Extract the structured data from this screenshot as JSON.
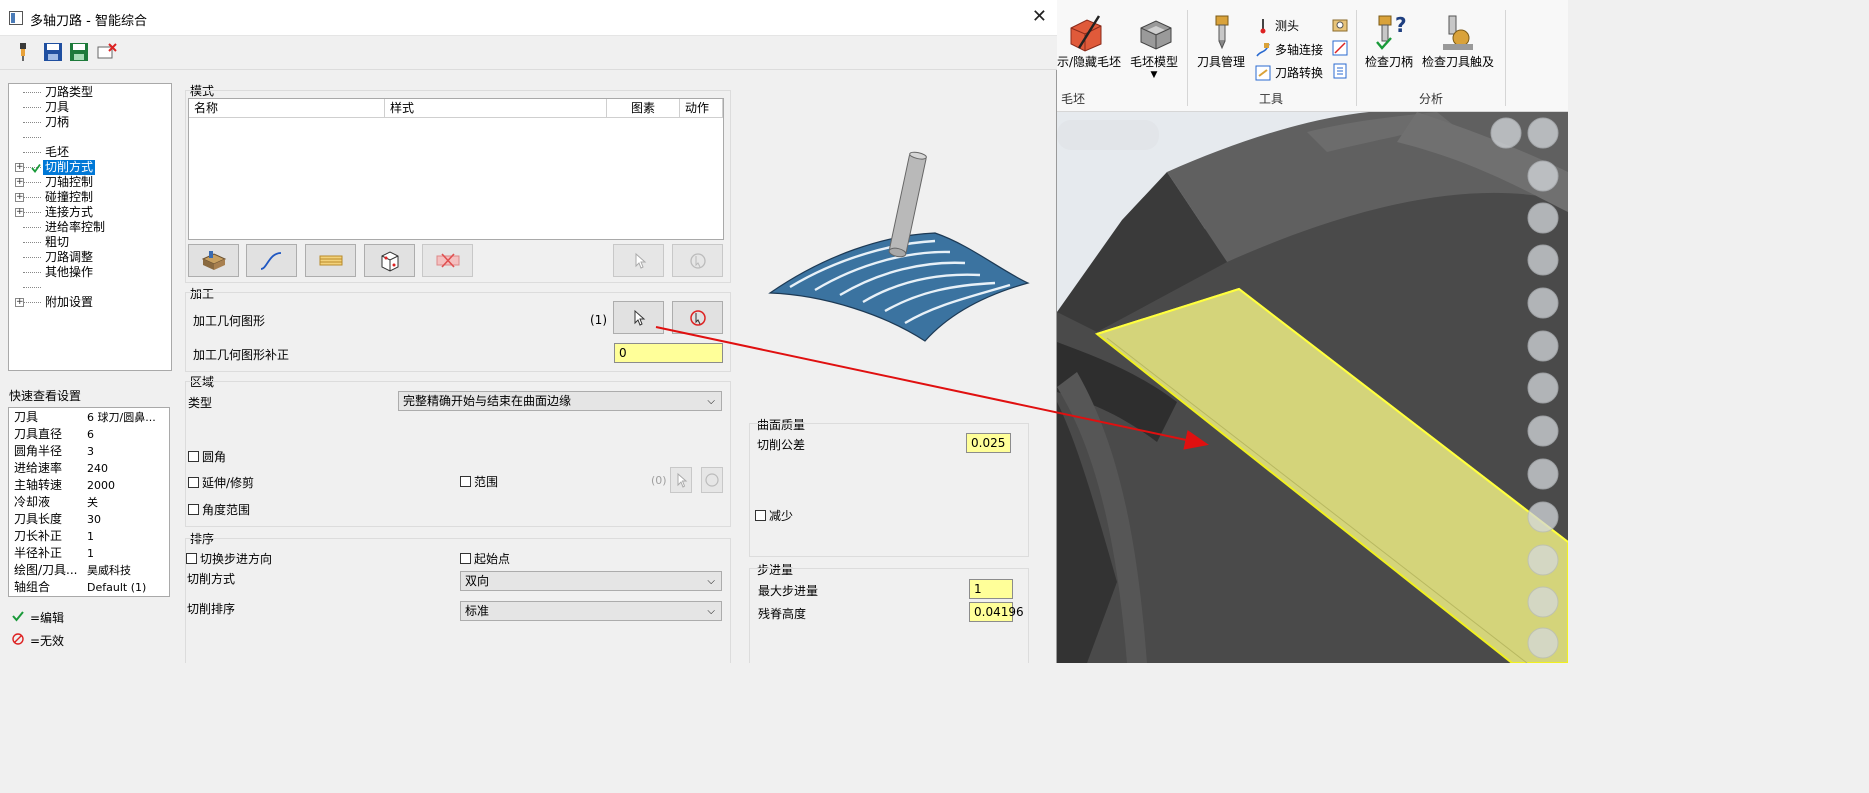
{
  "window": {
    "title": "多轴刀路 - 智能综合",
    "close_glyph": "✕"
  },
  "toolbar": {
    "icons": [
      "tool-icon",
      "save-icon",
      "save-as-icon",
      "delete-icon"
    ]
  },
  "tree": {
    "items": [
      {
        "label": "刀路类型",
        "expandable": false,
        "checked": false,
        "selected": false
      },
      {
        "label": "刀具",
        "expandable": false,
        "checked": false,
        "selected": false
      },
      {
        "label": "刀柄",
        "expandable": false,
        "checked": false,
        "selected": false
      },
      {
        "label": "",
        "expandable": false,
        "checked": false,
        "selected": false
      },
      {
        "label": "毛坯",
        "expandable": false,
        "checked": false,
        "selected": false
      },
      {
        "label": "切削方式",
        "expandable": true,
        "checked": true,
        "selected": true
      },
      {
        "label": "刀轴控制",
        "expandable": true,
        "checked": false,
        "selected": false
      },
      {
        "label": "碰撞控制",
        "expandable": true,
        "checked": false,
        "selected": false
      },
      {
        "label": "连接方式",
        "expandable": true,
        "checked": false,
        "selected": false
      },
      {
        "label": "进给率控制",
        "expandable": false,
        "checked": false,
        "selected": false
      },
      {
        "label": "粗切",
        "expandable": false,
        "checked": false,
        "selected": false
      },
      {
        "label": "刀路调整",
        "expandable": false,
        "checked": false,
        "selected": false
      },
      {
        "label": "其他操作",
        "expandable": false,
        "checked": false,
        "selected": false
      },
      {
        "label": "",
        "expandable": false,
        "checked": false,
        "selected": false
      },
      {
        "label": "附加设置",
        "expandable": true,
        "checked": false,
        "selected": false
      }
    ]
  },
  "quick_settings": {
    "title": "快速查看设置",
    "rows": [
      {
        "key": "刀具",
        "value": "6 球刀/圆鼻..."
      },
      {
        "key": "刀具直径",
        "value": "6"
      },
      {
        "key": "圆角半径",
        "value": "3"
      },
      {
        "key": "进给速率",
        "value": "240"
      },
      {
        "key": "主轴转速",
        "value": "2000"
      },
      {
        "key": "冷却液",
        "value": "关"
      },
      {
        "key": "刀具长度",
        "value": "30"
      },
      {
        "key": "刀长补正",
        "value": "1"
      },
      {
        "key": "半径补正",
        "value": "1"
      },
      {
        "key": "绘图/刀具...",
        "value": "昊威科技"
      },
      {
        "key": "轴组合",
        "value": "Default (1)"
      }
    ]
  },
  "legend": {
    "edit_label": "=编辑",
    "invalid_label": "=无效"
  },
  "pattern": {
    "title": "模式",
    "columns": [
      "名称",
      "样式",
      "图素",
      "动作"
    ]
  },
  "machining": {
    "title": "加工",
    "geometry_label": "加工几何图形",
    "geometry_count": "(1)",
    "offset_label": "加工几何图形补正",
    "offset_value": "0"
  },
  "region": {
    "title": "区域",
    "type_label": "类型",
    "type_value": "完整精确开始与结束在曲面边缘",
    "fillet_label": "圆角",
    "extend_label": "延伸/修剪",
    "range_label": "范围",
    "range_count": "(0)",
    "angle_range_label": "角度范围"
  },
  "surface_quality": {
    "title": "曲面质量",
    "tolerance_label": "切削公差",
    "tolerance_value": "0.025",
    "reduce_label": "减少"
  },
  "sorting": {
    "title": "排序",
    "switch_label": "切换步进方向",
    "start_label": "起始点",
    "cut_method_label": "切削方式",
    "cut_method_value": "双向",
    "cut_order_label": "切削排序",
    "cut_order_value": "标准"
  },
  "stepover": {
    "title": "步进量",
    "max_label": "最大步进量",
    "max_value": "1",
    "scallop_label": "残脊高度",
    "scallop_value": "0.04196"
  },
  "ribbon": {
    "show_hide_stock": "示/隐藏毛坯",
    "stock_model": "毛坯模型",
    "tool_manager": "刀具管理",
    "probe": "测头",
    "multiaxis_link": "多轴连接",
    "toolpath_transform": "刀路转换",
    "check_holder": "检查刀柄",
    "check_tool_reach": "检查刀具触及",
    "group_stock": "毛坯",
    "group_tools": "工具",
    "group_analysis": "分析"
  },
  "colors": {
    "accent_blue": "#0078d7",
    "input_yellow": "#ffff99",
    "arrow_red": "#e01010",
    "surface_blue": "#3b73a0"
  }
}
